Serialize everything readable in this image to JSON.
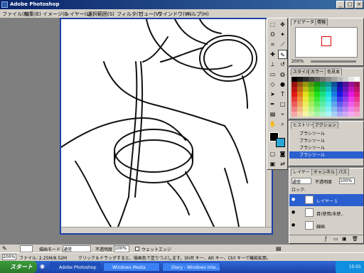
{
  "window": {
    "title": "Adobe Photoshop"
  },
  "menubar": [
    "ファイル(F)",
    "編集(E)",
    "イメージ(I)",
    "レイヤー(L)",
    "選択範囲(S)",
    "フィルタ(T)",
    "ビュー(V)",
    "ウインドウ(W)",
    "ヘルプ(H)"
  ],
  "navigator": {
    "tabs": [
      "ナビゲータ",
      "情報"
    ],
    "zoom": "200%"
  },
  "color_panel": {
    "tabs": [
      "スタイル",
      "カラー",
      "色見本"
    ]
  },
  "history": {
    "tabs": [
      "ヒストリー",
      "アクション"
    ],
    "items": [
      "ブラシツール",
      "ブラシツール",
      "ブラシツール",
      "ブラシツール"
    ]
  },
  "layers": {
    "tabs": [
      "レイヤー",
      "チャンネル",
      "パス"
    ],
    "blend_mode": "通常",
    "opacity_label": "不透明度",
    "opacity": "100%",
    "lock_label": "ロック:",
    "items": [
      {
        "name": "レイヤー 1"
      },
      {
        "name": "目(使用/未使.."
      },
      {
        "name": "線画"
      }
    ]
  },
  "options": {
    "mode_label": "描画モード :",
    "mode": "通常",
    "opacity_label": "不透明度",
    "opacity": "100%",
    "wet_label": "ウェットエッジ"
  },
  "status": {
    "zoom": "200%",
    "file": "ファイル: 2.25M/8.52M",
    "hint": "クリック＆ドラッグすると、描画色で塗りつぶします。Shift キー、Alt キー、Ctrl キーで機能拡張。"
  },
  "taskbar": {
    "start": "スタート",
    "items": [
      "Adobe Photoshop",
      "Windows Media Player",
      "Diary - Windows Inte..."
    ],
    "clock": "15:01"
  },
  "colors": {
    "accent": "#1e3fa8",
    "title_start": "#0a246a"
  }
}
